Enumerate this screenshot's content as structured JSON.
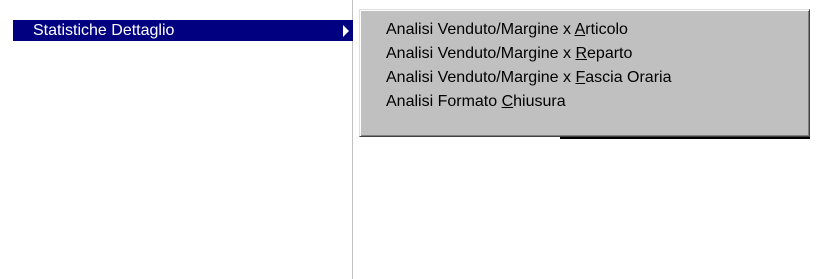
{
  "parent_menu": {
    "items": [
      {
        "label": "Statistiche Dettaglio",
        "has_submenu": true,
        "selected": true
      }
    ]
  },
  "submenu": {
    "items": [
      {
        "prefix": "Analisi Venduto/Margine x ",
        "accel": "A",
        "suffix": "rticolo"
      },
      {
        "prefix": "Analisi Venduto/Margine x ",
        "accel": "R",
        "suffix": "eparto"
      },
      {
        "prefix": "Analisi Venduto/Margine x ",
        "accel": "F",
        "suffix": "ascia Oraria"
      },
      {
        "prefix": "Analisi Formato ",
        "accel": "C",
        "suffix": "hiusura"
      }
    ]
  },
  "colors": {
    "selection": "#000080",
    "menu_face": "#c0c0c0"
  }
}
